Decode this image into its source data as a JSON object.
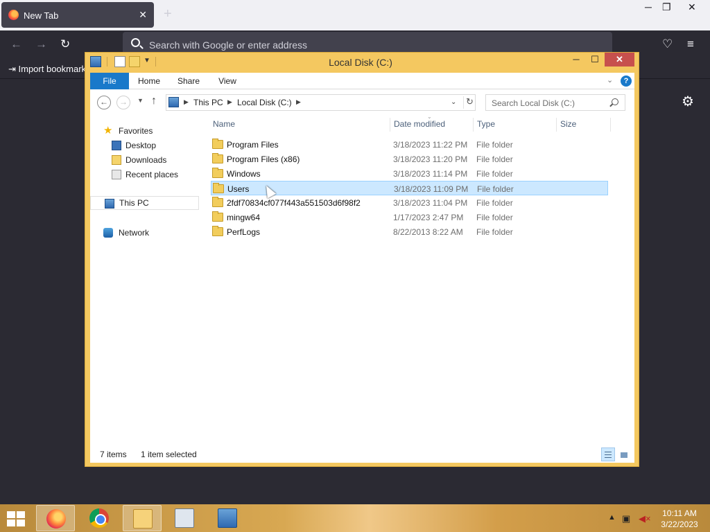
{
  "browser": {
    "tab_title": "New Tab",
    "tab_close": "✕",
    "new_tab_symbol": "+",
    "window_min": "─",
    "window_restore": "❐",
    "window_close": "✕",
    "address_placeholder": "Search with Google or enter address",
    "import_bookmarks": "Import bookmarks",
    "icons": [
      "back-arrow-icon",
      "forward-arrow-icon",
      "reload-icon",
      "pocket-icon",
      "hamburger-menu-icon",
      "settings-gear-icon"
    ]
  },
  "explorer": {
    "title": "Local Disk (C:)",
    "controls": {
      "minimize": "─",
      "maximize": "☐",
      "close": "✕"
    },
    "ribbon_tabs": [
      "File",
      "Home",
      "Share",
      "View"
    ],
    "help": "?",
    "breadcrumb": [
      "This PC",
      "Local Disk (C:)"
    ],
    "search_placeholder": "Search Local Disk (C:)",
    "nav_pane": {
      "favorites": "Favorites",
      "favorites_items": [
        "Desktop",
        "Downloads",
        "Recent places"
      ],
      "this_pc": "This PC",
      "network": "Network"
    },
    "columns": [
      "Name",
      "Date modified",
      "Type",
      "Size"
    ],
    "files": [
      {
        "name": "Program Files",
        "date": "3/18/2023 11:22 PM",
        "type": "File folder",
        "selected": false
      },
      {
        "name": "Program Files (x86)",
        "date": "3/18/2023 11:20 PM",
        "type": "File folder",
        "selected": false
      },
      {
        "name": "Windows",
        "date": "3/18/2023 11:14 PM",
        "type": "File folder",
        "selected": false
      },
      {
        "name": "Users",
        "date": "3/18/2023 11:09 PM",
        "type": "File folder",
        "selected": true
      },
      {
        "name": "2fdf70834cf077f443a551503d6f98f2",
        "date": "3/18/2023 11:04 PM",
        "type": "File folder",
        "selected": false
      },
      {
        "name": "mingw64",
        "date": "1/17/2023 2:47 PM",
        "type": "File folder",
        "selected": false
      },
      {
        "name": "PerfLogs",
        "date": "8/22/2013 8:22 AM",
        "type": "File folder",
        "selected": false
      }
    ],
    "status": {
      "item_count": "7 items",
      "selection": "1 item selected"
    },
    "colors": {
      "frame": "#f4c860",
      "file_tab": "#1979ca",
      "selection": "#cce8ff",
      "close_button": "#c7504d"
    }
  },
  "taskbar": {
    "apps": [
      "firefox-icon",
      "chrome-icon",
      "file-explorer-icon",
      "calculator-icon",
      "remote-desktop-icon"
    ],
    "tray_icons": [
      "show-hidden-icons-chevron",
      "network-icon",
      "volume-muted-icon"
    ],
    "time": "10:11 AM",
    "date": "3/22/2023"
  }
}
